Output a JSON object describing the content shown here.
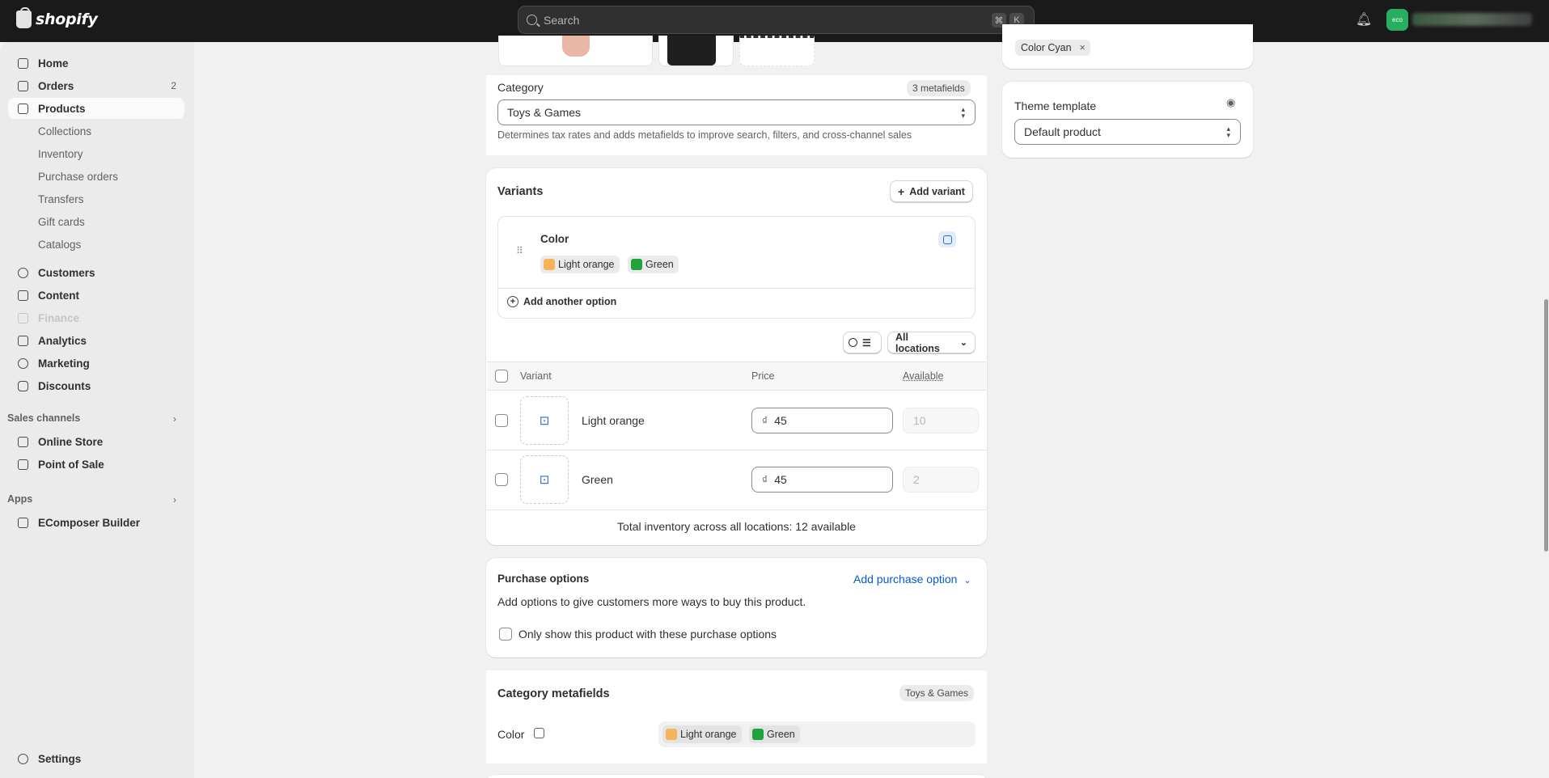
{
  "topbar": {
    "logo_text": "shopify",
    "search_placeholder": "Search",
    "shortcut_cmd": "⌘",
    "shortcut_key": "K",
    "bell_icon": "bell-icon",
    "avatar_text": "eco"
  },
  "sidebar": {
    "items": [
      {
        "label": "Home",
        "icon": "home-icon"
      },
      {
        "label": "Orders",
        "icon": "inbox-icon",
        "count": "2"
      },
      {
        "label": "Products",
        "icon": "tag-icon"
      },
      {
        "label": "Customers",
        "icon": "person-icon"
      },
      {
        "label": "Content",
        "icon": "document-icon"
      },
      {
        "label": "Finance",
        "icon": "bank-icon"
      },
      {
        "label": "Analytics",
        "icon": "chart-icon"
      },
      {
        "label": "Marketing",
        "icon": "target-icon"
      },
      {
        "label": "Discounts",
        "icon": "discount-icon"
      }
    ],
    "product_subitems": [
      "Collections",
      "Inventory",
      "Purchase orders",
      "Transfers",
      "Gift cards",
      "Catalogs"
    ],
    "sales_channels_label": "Sales channels",
    "sales_channels": [
      "Online Store",
      "Point of Sale"
    ],
    "apps_label": "Apps",
    "apps": [
      "EComposer Builder"
    ],
    "settings_label": "Settings"
  },
  "category": {
    "label": "Category",
    "metafields_badge": "3 metafields",
    "value": "Toys & Games",
    "help": "Determines tax rates and adds metafields to improve search, filters, and cross-channel sales"
  },
  "variants": {
    "title": "Variants",
    "add_variant": "Add variant",
    "option_name": "Color",
    "option_values": [
      {
        "label": "Light orange",
        "color": "#f5b35b"
      },
      {
        "label": "Green",
        "color": "#1fa33f"
      }
    ],
    "add_option": "Add another option",
    "all_locations": "All locations",
    "col_variant": "Variant",
    "col_price": "Price",
    "col_available": "Available",
    "rows": [
      {
        "name": "Light orange",
        "currency": "₫",
        "price": "45",
        "available": "10"
      },
      {
        "name": "Green",
        "currency": "₫",
        "price": "45",
        "available": "2"
      }
    ],
    "total": "Total inventory across all locations: 12 available"
  },
  "purchase_options": {
    "title": "Purchase options",
    "add_link": "Add purchase option",
    "description": "Add options to give customers more ways to buy this product.",
    "checkbox_label": "Only show this product with these purchase options"
  },
  "category_metafields": {
    "title": "Category metafields",
    "badge": "Toys & Games",
    "field_label": "Color",
    "values": [
      {
        "label": "Light orange",
        "color": "#f5b35b"
      },
      {
        "label": "Green",
        "color": "#1fa33f"
      }
    ]
  },
  "right": {
    "tag_chip": "Color Cyan",
    "theme_template_label": "Theme template",
    "theme_template_value": "Default product"
  }
}
